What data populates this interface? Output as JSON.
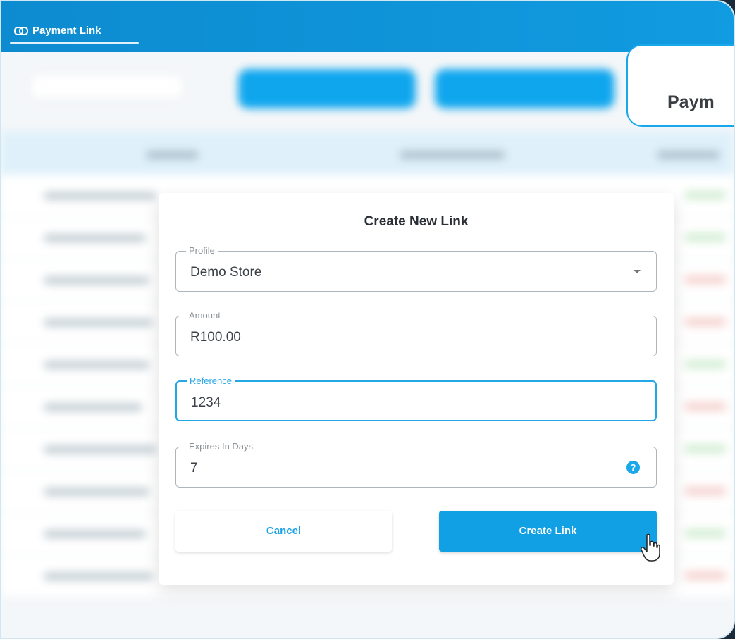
{
  "header": {
    "tab_label": "Payment Link",
    "tab_icon": "link-icon",
    "accent": "#119be0"
  },
  "callout": {
    "text": "Paym"
  },
  "dialog": {
    "title": "Create New Link",
    "fields": {
      "profile": {
        "label": "Profile",
        "value": "Demo Store"
      },
      "amount": {
        "label": "Amount",
        "value": "R100.00"
      },
      "reference": {
        "label": "Reference",
        "value": "1234"
      },
      "expires": {
        "label": "Expires In Days",
        "value": "7",
        "help": "?"
      }
    },
    "buttons": {
      "cancel": "Cancel",
      "create": "Create Link"
    }
  }
}
